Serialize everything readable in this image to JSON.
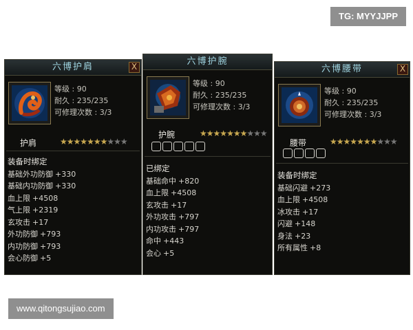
{
  "watermarks": {
    "top": "TG: MYYJJPP",
    "bottom": "www.qitongsujiao.com"
  },
  "colors": {
    "panel_bg": "#0e0e0c",
    "title_text": "#9fd4e0",
    "star_on": "#c8a850",
    "star_off": "#777777"
  },
  "panels": [
    {
      "title": "六博护肩",
      "has_close": true,
      "close_label": "X",
      "icon": "shoulder-armor-icon",
      "level_label": "等级 : 90",
      "durability_label": "耐久 : 235/235",
      "repair_label": "可修理次数 : 3/3",
      "item_name": "护肩",
      "stars_filled": 7,
      "stars_total": 10,
      "slot_count": 0,
      "bind_text": "装备时绑定",
      "attributes": [
        {
          "name": "基础外功防御",
          "value": "+330"
        },
        {
          "name": "基础内功防御",
          "value": "+330"
        },
        {
          "name": "血上限",
          "value": "+4508"
        },
        {
          "name": "气上限",
          "value": "+2319"
        },
        {
          "name": "玄攻击",
          "value": "+17"
        },
        {
          "name": "外功防御",
          "value": "+793"
        },
        {
          "name": "内功防御",
          "value": "+793"
        },
        {
          "name": "会心防御",
          "value": "+5"
        }
      ]
    },
    {
      "title": "六博护腕",
      "has_close": false,
      "icon": "wrist-guard-icon",
      "level_label": "等级 : 90",
      "durability_label": "耐久 : 235/235",
      "repair_label": "可修理次数 : 3/3",
      "item_name": "护腕",
      "stars_filled": 7,
      "stars_total": 10,
      "slot_count": 5,
      "bind_text": "已绑定",
      "attributes": [
        {
          "name": "基础命中",
          "value": "+820"
        },
        {
          "name": "血上限",
          "value": "+4508"
        },
        {
          "name": "玄攻击",
          "value": "+17"
        },
        {
          "name": "外功攻击",
          "value": "+797"
        },
        {
          "name": "内功攻击",
          "value": "+797"
        },
        {
          "name": "命中",
          "value": "+443"
        },
        {
          "name": "会心",
          "value": "+5"
        }
      ]
    },
    {
      "title": "六博腰带",
      "has_close": true,
      "close_label": "X",
      "icon": "belt-icon",
      "level_label": "等级 : 90",
      "durability_label": "耐久 : 235/235",
      "repair_label": "可修理次数 : 3/3",
      "item_name": "腰带",
      "stars_filled": 7,
      "stars_total": 10,
      "slot_count": 4,
      "bind_text": "装备时绑定",
      "attributes": [
        {
          "name": "基础闪避",
          "value": "+273"
        },
        {
          "name": "血上限",
          "value": "+4508"
        },
        {
          "name": "冰攻击",
          "value": "+17"
        },
        {
          "name": "闪避",
          "value": "+148"
        },
        {
          "name": "身法",
          "value": "+23"
        },
        {
          "name": "所有属性",
          "value": "+8"
        }
      ]
    }
  ]
}
